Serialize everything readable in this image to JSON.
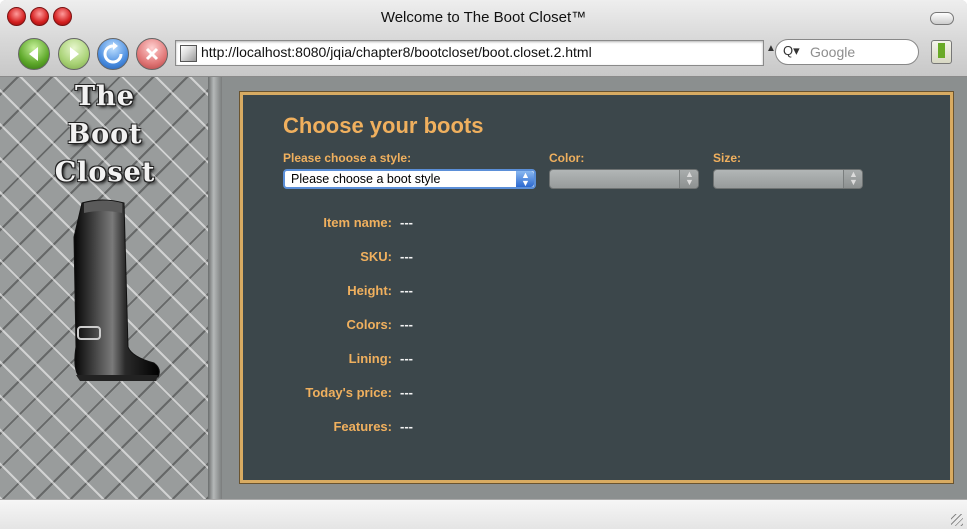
{
  "window": {
    "title": "Welcome to The Boot Closet™"
  },
  "toolbar": {
    "url": "http://localhost:8080/jqia/chapter8/bootcloset/boot.closet.2.html",
    "search_placeholder": "Google",
    "search_icon": "Q▾"
  },
  "sidebar": {
    "logo_line1": "The",
    "logo_line2": "Boot",
    "logo_line3": "Closet"
  },
  "form": {
    "heading": "Choose your boots",
    "style_label": "Please choose a style:",
    "style_value": "Please choose a boot style",
    "color_label": "Color:",
    "size_label": "Size:"
  },
  "details": [
    {
      "label": "Item name:",
      "value": "---"
    },
    {
      "label": "SKU:",
      "value": "---"
    },
    {
      "label": "Height:",
      "value": "---"
    },
    {
      "label": "Colors:",
      "value": "---"
    },
    {
      "label": "Lining:",
      "value": "---"
    },
    {
      "label": "Today's price:",
      "value": "---"
    },
    {
      "label": "Features:",
      "value": "---"
    }
  ],
  "colors": {
    "accent": "#f0b05e",
    "panel": "#3c474b",
    "panel_border": "#d8ab62"
  }
}
